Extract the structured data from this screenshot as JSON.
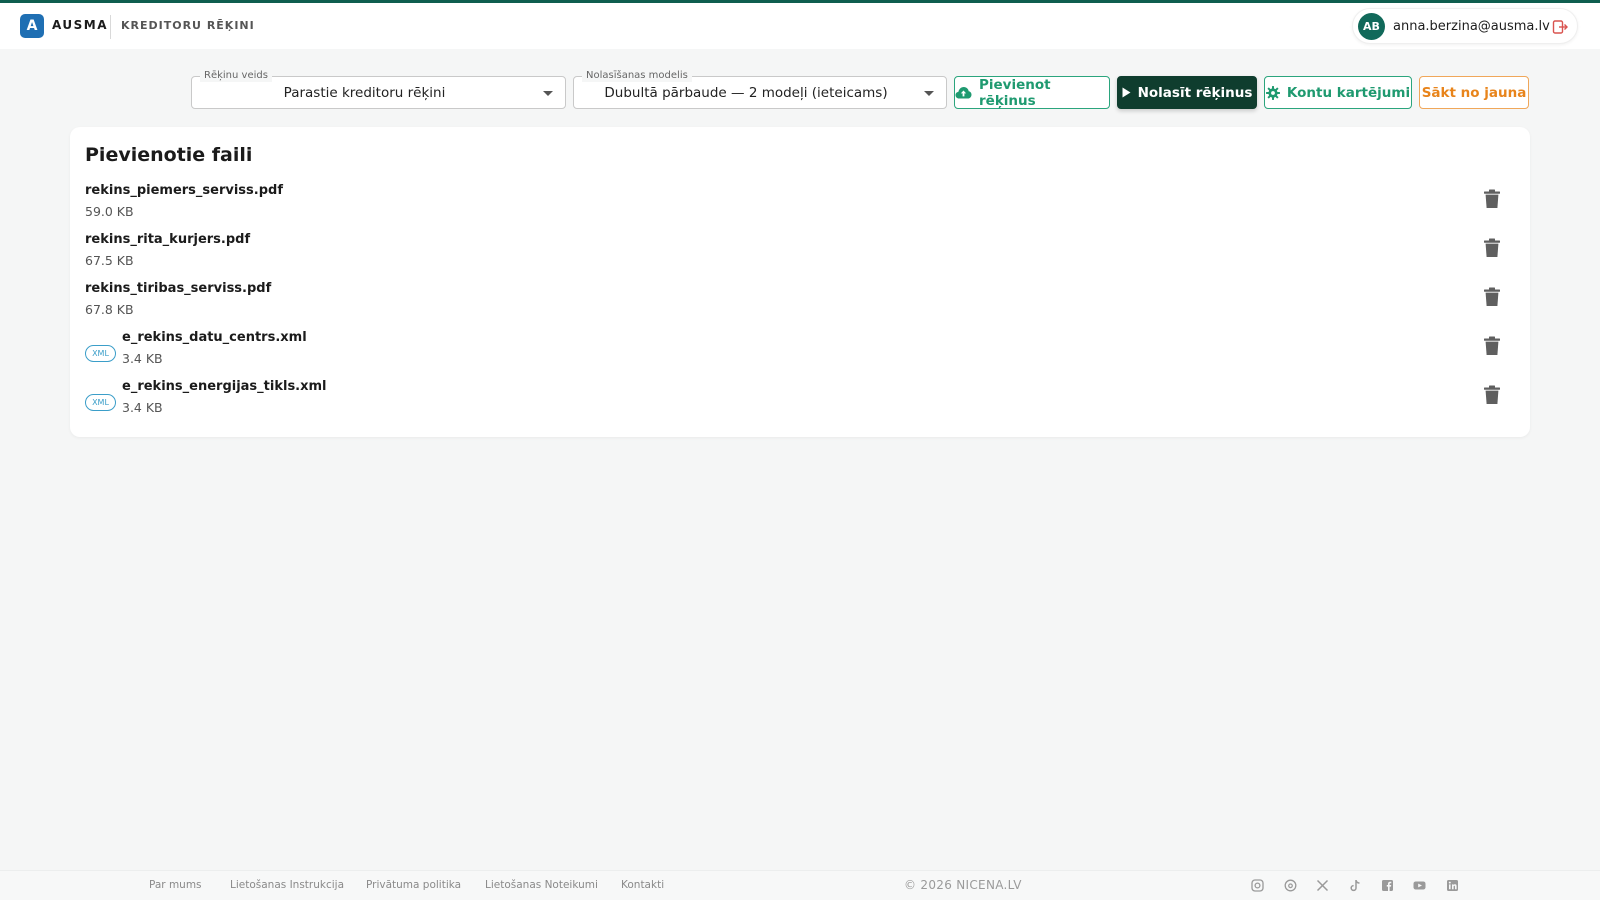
{
  "app": {
    "logo_letter": "A",
    "brand": "AUSMA",
    "section": "KREDITORU RĒĶINI"
  },
  "user": {
    "initials": "AB",
    "email": "anna.berzina@ausma.lv"
  },
  "toolbar": {
    "invoice_type_legend": "Rēķinu veids",
    "invoice_type_value": "Parastie kreditoru rēķini",
    "model_legend": "Nolasīšanas modelis",
    "model_value": "Dubultā pārbaude — 2 modeļi (ieteicams)",
    "add_label": "Pievienot rēķinus",
    "read_label": "Nolasīt rēķinus",
    "accounts_label": "Kontu kartējumi",
    "restart_label": "Sākt no jauna"
  },
  "files": {
    "title": "Pievienotie faili",
    "items": [
      {
        "name": "rekins_piemers_serviss.pdf",
        "size": "59.0 KB",
        "badge": ""
      },
      {
        "name": "rekins_rita_kurjers.pdf",
        "size": "67.5 KB",
        "badge": ""
      },
      {
        "name": "rekins_tiribas_serviss.pdf",
        "size": "67.8 KB",
        "badge": ""
      },
      {
        "name": "e_rekins_datu_centrs.xml",
        "size": "3.4 KB",
        "badge": "XML"
      },
      {
        "name": "e_rekins_energijas_tikls.xml",
        "size": "3.4 KB",
        "badge": "XML"
      }
    ]
  },
  "footer": {
    "links": [
      "Par mums",
      "Lietošanas Instrukcija",
      "Privātuma politika",
      "Lietošanas Noteikumi",
      "Kontakti"
    ],
    "copyright": "© 2026 NICENA.LV",
    "social_icons": [
      "instagram-icon",
      "threads-icon",
      "x-icon",
      "tiktok-icon",
      "facebook-icon",
      "youtube-icon",
      "linkedin-icon"
    ]
  },
  "colors": {
    "accent_dark": "#0f3d2e",
    "accent_green": "#1f9a70",
    "accent_orange": "#e8841b",
    "logo_blue": "#1f6fb3",
    "xml_badge": "#3b9ec9",
    "logout_red": "#d9534f"
  }
}
